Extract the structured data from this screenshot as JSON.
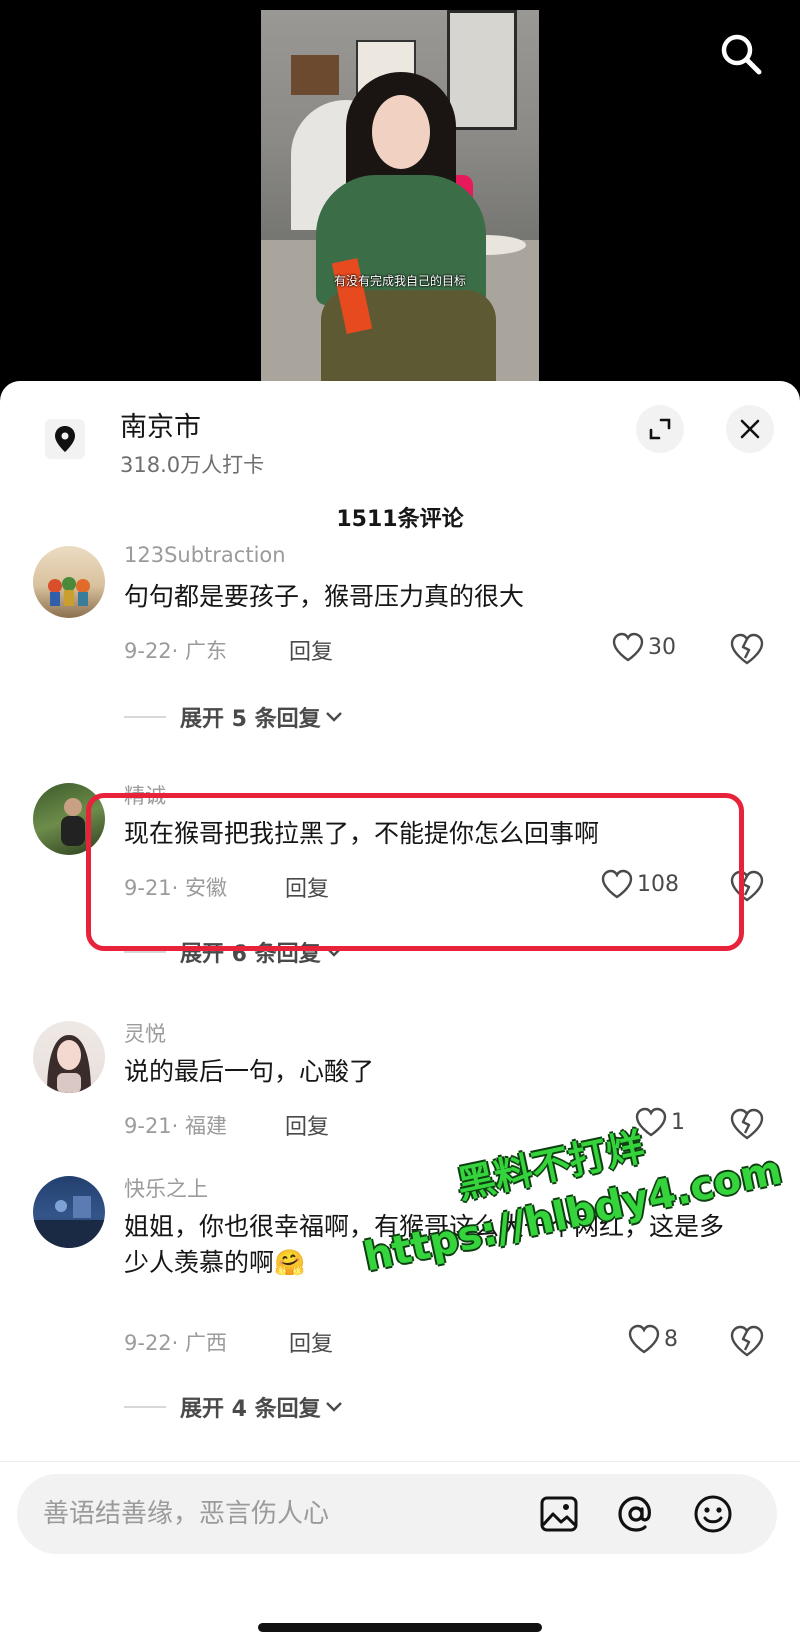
{
  "video": {
    "caption": "有没有完成我自己的目标"
  },
  "location": {
    "title": "南京市",
    "subtitle": "318.0万人打卡"
  },
  "comments_header": "1511条评论",
  "comments": [
    {
      "user": "123Subtraction",
      "text": "句句都是要孩子，猴哥压力真的很大",
      "meta": "9-22· 广东",
      "reply": "回复",
      "likes": "30",
      "expand": "展开 5 条回复"
    },
    {
      "user": "精诚",
      "text": "现在猴哥把我拉黑了，不能提你怎么回事啊",
      "meta": "9-21· 安徽",
      "reply": "回复",
      "likes": "108",
      "expand": "展开 6 条回复"
    },
    {
      "user": "灵悦",
      "text": "说的最后一句，心酸了",
      "meta": "9-21· 福建",
      "reply": "回复",
      "likes": "1"
    },
    {
      "user": "快乐之上",
      "text": "姐姐，你也很幸福啊，有猴哥这么大一个网红，这是多少人羡慕的啊🤗",
      "meta": "9-22· 广西",
      "reply": "回复",
      "likes": "8",
      "expand": "展开 4 条回复"
    }
  ],
  "watermark": {
    "line1": "黑料不打烊",
    "line2": "https://hlbdy4.com"
  },
  "input": {
    "placeholder": "善语结善缘，恶言伤人心"
  },
  "colors": {
    "highlight": "#e8223a",
    "watermark": "#35d43c"
  },
  "icons": [
    "search-icon",
    "location-pin-icon",
    "expand-icon",
    "close-icon",
    "heart-icon",
    "dislike-heart-icon",
    "image-icon",
    "at-icon",
    "emoji-icon"
  ]
}
